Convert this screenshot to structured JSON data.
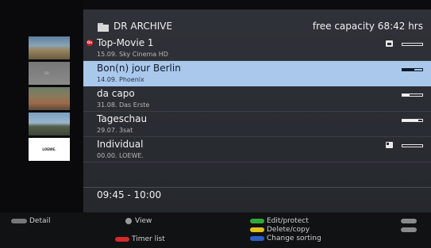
{
  "header": {
    "title": "DR ARCHIVE",
    "capacity": "free capacity 68:42 hrs"
  },
  "recordings": [
    {
      "name": "Top-Movie 1",
      "meta": "15.09.  Sky Cinema HD",
      "progress": 0.0,
      "badge": "new",
      "status_icon": "lock-icon"
    },
    {
      "name": "Bon(n) jour Berlin",
      "meta": "14.09.  Phoenix",
      "progress": 0.6,
      "badge": "",
      "status_icon": ""
    },
    {
      "name": "da capo",
      "meta": "31.08.  Das Erste",
      "progress": 0.35,
      "badge": "",
      "status_icon": ""
    },
    {
      "name": "Tageschau",
      "meta": "29.07.  3sat",
      "progress": 0.8,
      "badge": "",
      "status_icon": ""
    },
    {
      "name": "Individual",
      "meta": "00.00.  LOEWE.",
      "progress": 0.0,
      "badge": "",
      "status_icon": "protect-icon"
    }
  ],
  "thumbnails": [
    "scenic-thumbnail",
    "blank-thumbnail",
    "city-thumbnail",
    "church-thumbnail",
    "loewe-logo-thumbnail"
  ],
  "thumb_logo_text": "LOEWE.",
  "thumb_blank_text": "DR",
  "selected_index": 1,
  "timeslot": "09:45 - 10:00",
  "footer": {
    "detail_label": "Detail",
    "view_label": "View",
    "timer_label": "Timer list",
    "edit_label": "Edit/protect",
    "delete_label": "Delete/copy",
    "sort_label": "Change sorting",
    "text_key": "TEXT",
    "end_key": "END",
    "info_key": "INFO"
  },
  "colors": {
    "selection": "#aac8ec",
    "green_key": "#31a83a",
    "yellow_key": "#e0c21a",
    "blue_key": "#2d5fc9",
    "red_key": "#d32a2a",
    "new_badge": "#d21f25"
  }
}
